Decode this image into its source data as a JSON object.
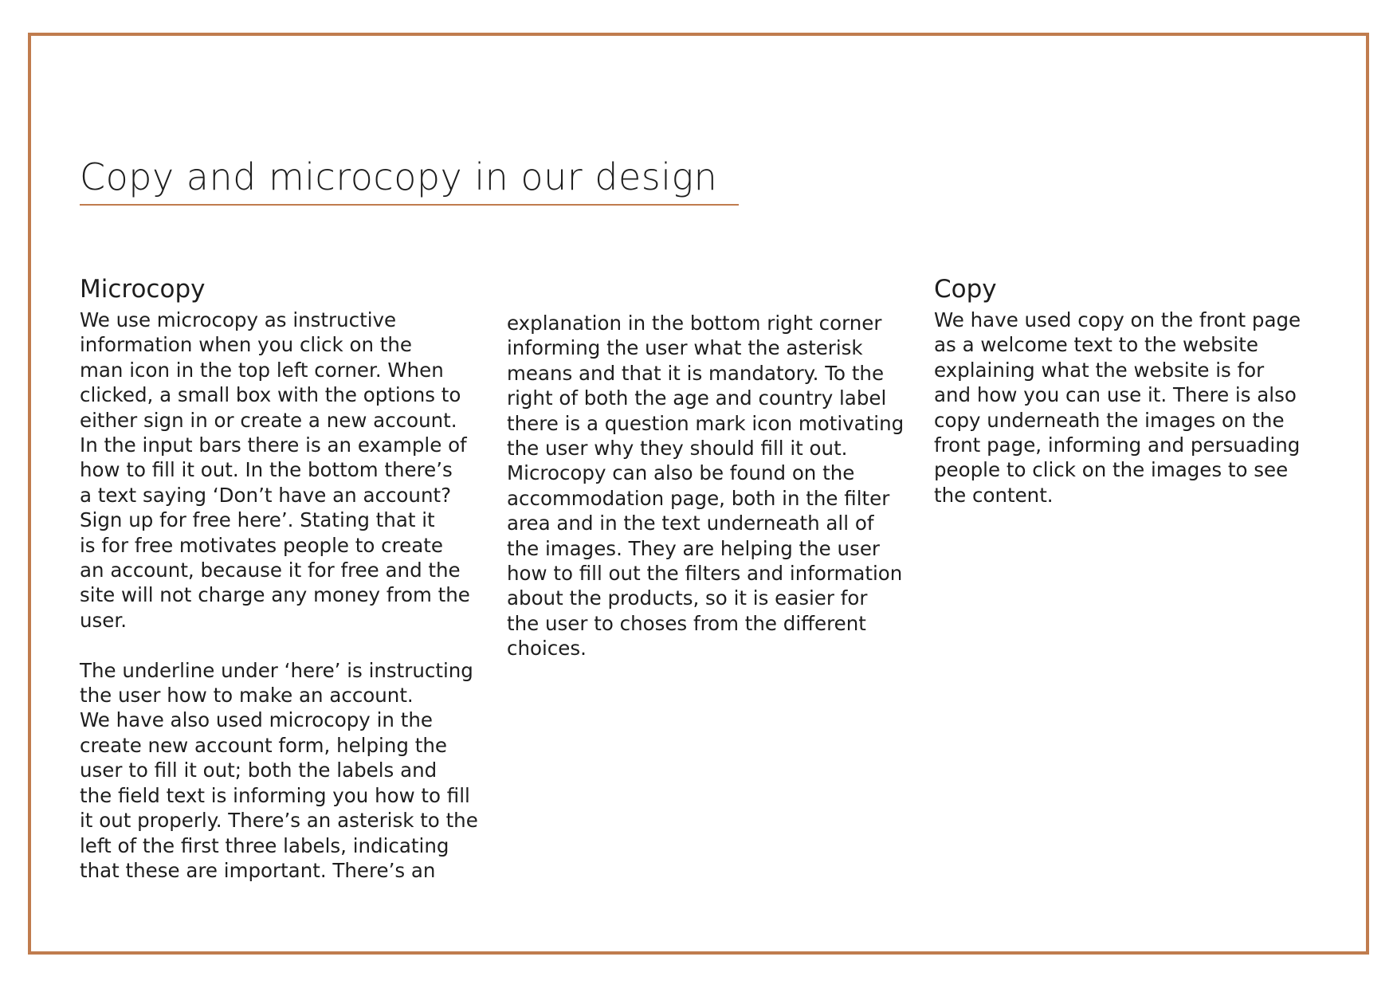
{
  "title": "Copy and microcopy in our design",
  "colors": {
    "accent": "#c07c4e",
    "text": "#1e1e1e",
    "background": "#ffffff"
  },
  "microcopy": {
    "heading": "Microcopy",
    "paragraph1": [
      "We use microcopy as instructive",
      "information when you click on the",
      "man icon in the top left corner. When",
      "clicked, a small box with the options to",
      "either sign in or create a new account.",
      "In the input bars there is an example of",
      "how to fill it out. In the bottom there’s",
      "a text saying ‘Don’t have an account?",
      "Sign up for free here’. Stating that it",
      "is for free motivates people to create",
      "an account, because it for free and the",
      "site will not charge any money from the",
      "user."
    ],
    "paragraph2": [
      "The underline under ‘here’ is instructing",
      "the user how to make an account.",
      "We have also used microcopy in the",
      "create new account form, helping the",
      "user to fill it out; both the labels and",
      "the field text is informing you how to fill",
      "it out properly. There’s an asterisk to the",
      "left of the first three labels, indicating",
      "that these are important. There’s an"
    ],
    "continuation": [
      "explanation in the bottom right corner",
      "informing the user what the asterisk",
      "means and that it is mandatory. To the",
      "right of both the age and country label",
      "there is a question mark icon motivating",
      "the user why they should fill it out.",
      "Microcopy can also be found on the",
      "accommodation page, both in the filter",
      "area and in the text underneath all of",
      "the images. They are helping the user",
      "how to fill out the filters and information",
      "about the products, so it is easier for",
      "the user to choses from the different",
      "choices."
    ]
  },
  "copy": {
    "heading": "Copy",
    "paragraph": [
      "We have used copy on the front page",
      "as a welcome text to the website",
      "explaining what the website is for",
      "and how you can use it. There is also",
      "copy underneath the images on the",
      "front page, informing and persuading",
      "people to click on the images to see",
      "the content."
    ]
  }
}
